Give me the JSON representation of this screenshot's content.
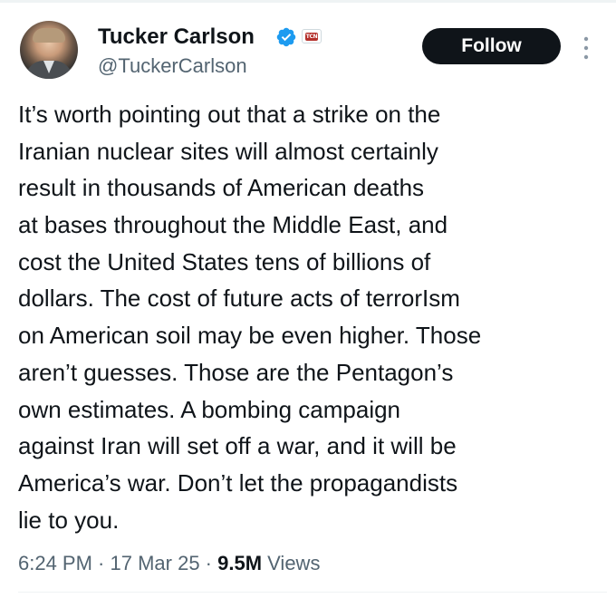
{
  "author": {
    "display_name": "Tucker Carlson",
    "handle": "@TuckerCarlson",
    "verified": true,
    "affiliate_badge_text": "TCN"
  },
  "actions": {
    "follow_label": "Follow",
    "more_icon": "more-vertical-icon"
  },
  "tweet": {
    "lines": [
      "It’s worth pointing out that a strike on the",
      "Iranian nuclear sites will almost certainly",
      "result in thousands of American deaths",
      "at bases throughout the Middle East, and",
      "cost the United States tens of billions of",
      "dollars. The cost of future acts of terrorIsm",
      "on American soil may be even higher. Those",
      "aren’t guesses. Those are the Pentagon’s",
      "own estimates. A bombing campaign",
      "against Iran will set off a war, and it will be",
      "America’s war. Don’t let the propagandists",
      "lie to you."
    ]
  },
  "meta": {
    "time": "6:24 PM",
    "separator": " · ",
    "date": "17 Mar 25",
    "views_count": "9.5M",
    "views_label": " Views"
  },
  "colors": {
    "text_primary": "#0f1419",
    "text_secondary": "#536471",
    "verified_blue": "#1d9bf0",
    "follow_bg": "#0f1419",
    "badge_red": "#b5312c"
  }
}
